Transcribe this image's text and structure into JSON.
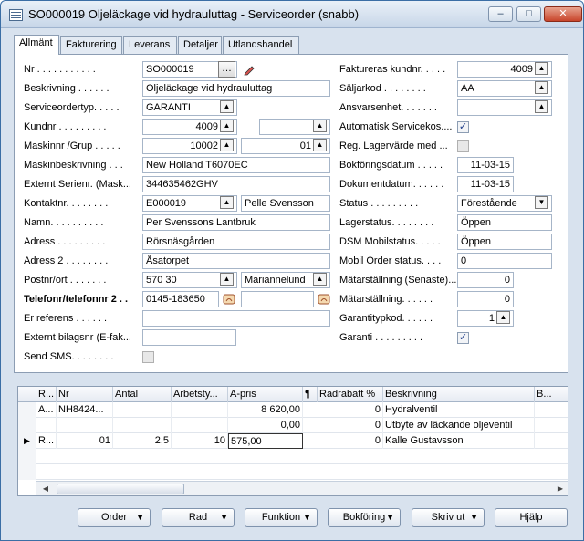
{
  "window": {
    "title": "SO000019 Oljeläckage vid hydrauluttag - Serviceorder (snabb)",
    "controls": {
      "minimize": "–",
      "maximize": "□",
      "close": "✕"
    }
  },
  "tabs": [
    "Allmänt",
    "Fakturering",
    "Leverans",
    "Detaljer",
    "Utlandshandel"
  ],
  "left": {
    "nr": {
      "label": "Nr . . . . . . . . . . .",
      "value": "SO000019"
    },
    "beskrivning": {
      "label": "Beskrivning . . . . . .",
      "value": "Oljeläckage vid hydrauluttag"
    },
    "serviceordertyp": {
      "label": "Serviceordertyp. . . . .",
      "value": "GARANTI"
    },
    "kundnr": {
      "label": "Kundnr . . . . . . . . .",
      "value": "4009",
      "value2": ""
    },
    "maskinnr": {
      "label": "Maskinnr /Grup . . . . .",
      "value": "10002",
      "value2": "01"
    },
    "maskinbeskrivning": {
      "label": "Maskinbeskrivning . . .",
      "value": "New Holland T6070EC"
    },
    "externt_serienr": {
      "label": "Externt Serienr. (Mask...",
      "value": "344635462GHV"
    },
    "kontaktnr": {
      "label": "Kontaktnr. . . . . . . .",
      "value": "E000019",
      "value2": "Pelle Svensson"
    },
    "namn": {
      "label": "Namn. . . . . . . . . .",
      "value": "Per Svenssons Lantbruk"
    },
    "adress": {
      "label": "Adress . . . . . . . . .",
      "value": "Rörsnäsgården"
    },
    "adress2": {
      "label": "Adress 2 . . . . . . . .",
      "value": "Åsatorpet"
    },
    "postnr": {
      "label": "Postnr/ort . . . . . . .",
      "value": "570 30",
      "value2": "Mariannelund"
    },
    "telefon": {
      "label": "Telefonr/telefonnr 2 . .",
      "value": "0145-183650",
      "value2": ""
    },
    "er_referens": {
      "label": "Er referens . . . . . .",
      "value": ""
    },
    "externt_bilagsnr": {
      "label": "Externt bilagsnr (E-fak...",
      "value": ""
    },
    "send_sms": {
      "label": "Send SMS. . . . . . . .",
      "checked": false
    }
  },
  "right": {
    "faktureras_kundnr": {
      "label": "Faktureras kundnr. . . . .",
      "value": "4009"
    },
    "saljarkod": {
      "label": "Säljarkod . . . . . . . .",
      "value": "AA"
    },
    "ansvarsenhet": {
      "label": "Ansvarsenhet. . . . . . .",
      "value": ""
    },
    "automatisk_servicekos": {
      "label": "Automatisk Servicekos....",
      "checked": true
    },
    "reg_lagervarde": {
      "label": "Reg. Lagervärde med ...",
      "checked": false
    },
    "bokforingsdatum": {
      "label": "Bokföringsdatum . . . . .",
      "value": "11-03-15"
    },
    "dokumentdatum": {
      "label": "Dokumentdatum. . . . . .",
      "value": "11-03-15"
    },
    "status": {
      "label": "Status . . . . . . . . .",
      "value": "Förestående"
    },
    "lagerstatus": {
      "label": "Lagerstatus. . . . . . . .",
      "value": "Öppen"
    },
    "dsm_mobilstatus": {
      "label": "DSM Mobilstatus. . . . .",
      "value": "Öppen"
    },
    "mobil_order_status": {
      "label": "Mobil Order status. . . .",
      "value": "0"
    },
    "matarstallning_senaste": {
      "label": "Mätarställning (Senaste)...",
      "value": "0"
    },
    "matarstallning": {
      "label": "Mätarställning. . . . . .",
      "value": "0"
    },
    "garantitypkod": {
      "label": "Garantitypkod. . . . . .",
      "value": "1"
    },
    "garanti": {
      "label": "Garanti . . . . . . . . .",
      "checked": true
    }
  },
  "lines": {
    "headers": [
      "R...",
      "Nr",
      "Antal",
      "Arbetsty...",
      "A-pris",
      "¶",
      "Radrabatt %",
      "Beskrivning",
      "B..."
    ],
    "rows": [
      {
        "marker": "",
        "r": "A...",
        "nr": "NH8424...",
        "antal": "",
        "arbetstyp": "",
        "apris": "8 620,00",
        "rabatt": "0",
        "beskrivning": "Hydralventil"
      },
      {
        "marker": "",
        "r": "",
        "nr": "",
        "antal": "",
        "arbetstyp": "",
        "apris": "0,00",
        "rabatt": "0",
        "beskrivning": "Utbyte av läckande oljeventil"
      },
      {
        "marker": "▶",
        "r": "R...",
        "nr": "01",
        "antal": "2,5",
        "arbetstyp": "10",
        "apris": "575,00",
        "rabatt": "0",
        "beskrivning": "Kalle Gustavsson"
      },
      {
        "marker": "",
        "r": "",
        "nr": "",
        "antal": "",
        "arbetstyp": "",
        "apris": "",
        "rabatt": "",
        "beskrivning": ""
      },
      {
        "marker": "",
        "r": "",
        "nr": "",
        "antal": "",
        "arbetstyp": "",
        "apris": "",
        "rabatt": "",
        "beskrivning": ""
      }
    ]
  },
  "buttons": {
    "order": "Order",
    "rad": "Rad",
    "funktion": "Funktion",
    "bokforing": "Bokföring",
    "skriv_ut": "Skriv ut",
    "hjalp": "Hjälp"
  }
}
